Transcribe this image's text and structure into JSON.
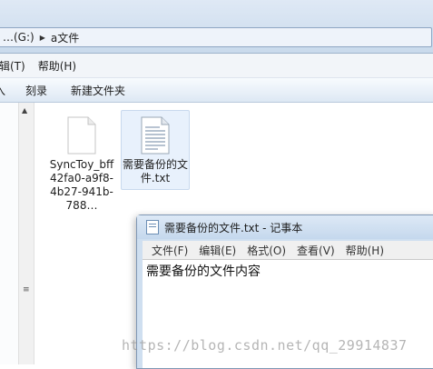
{
  "address": {
    "drive": "…(G:)",
    "folder": "a文件"
  },
  "menu": {
    "items": [
      "编辑(T)",
      "帮助(H)"
    ]
  },
  "command_bar": {
    "items": [
      "入",
      "刻录",
      "新建文件夹"
    ]
  },
  "files": [
    {
      "name": "SyncToy_bff42fa0-a9f8-4b27-941b-788…",
      "selected": false
    },
    {
      "name": "需要备份的文件.txt",
      "selected": true
    }
  ],
  "notepad": {
    "title": "需要备份的文件.txt - 记事本",
    "menu": [
      "文件(F)",
      "编辑(E)",
      "格式(O)",
      "查看(V)",
      "帮助(H)"
    ],
    "content": "需要备份的文件内容"
  },
  "watermark": "https://blog.csdn.net/qq_29914837"
}
